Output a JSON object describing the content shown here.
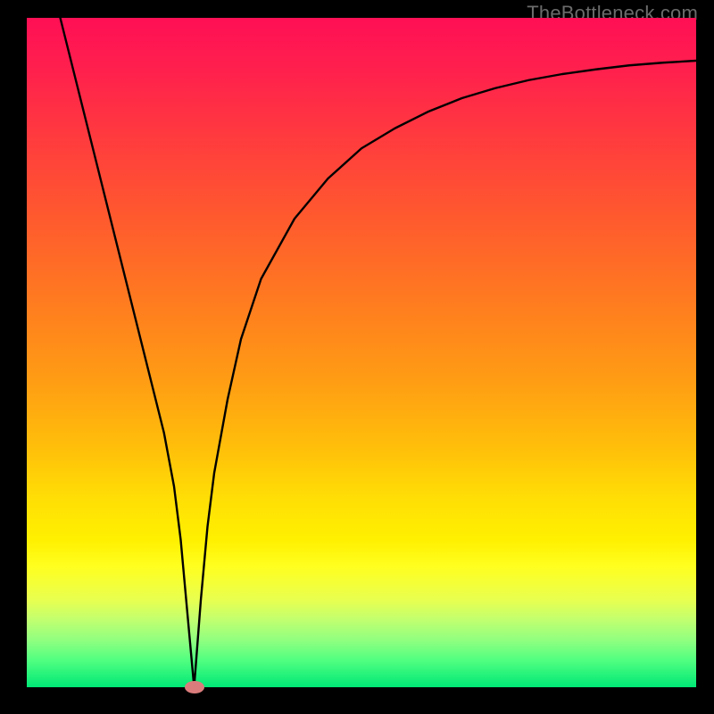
{
  "watermark": "TheBottleneck.com",
  "chart_data": {
    "type": "line",
    "title": "",
    "xlabel": "",
    "ylabel": "",
    "xlim": [
      0,
      100
    ],
    "ylim": [
      0,
      100
    ],
    "series": [
      {
        "name": "curve",
        "x": [
          5,
          7,
          9,
          11,
          13,
          15,
          17,
          19,
          20.5,
          22,
          23,
          24,
          25,
          26,
          27,
          28,
          30,
          32,
          35,
          40,
          45,
          50,
          55,
          60,
          65,
          70,
          75,
          80,
          85,
          90,
          95,
          100
        ],
        "values": [
          100,
          92,
          84,
          76,
          68,
          60,
          52,
          44,
          38,
          30,
          22,
          11,
          0,
          13,
          24,
          32,
          43,
          52,
          61,
          70,
          76,
          80.5,
          83.5,
          86,
          88,
          89.5,
          90.7,
          91.6,
          92.3,
          92.9,
          93.3,
          93.6
        ]
      }
    ],
    "marker": {
      "x": 25,
      "y": 0,
      "color": "#db7c7c"
    },
    "background_gradient": {
      "top": "#ff0f55",
      "mid_upper": "#ff7a20",
      "mid": "#ffdf05",
      "mid_lower": "#c0ff70",
      "bottom": "#00e876"
    }
  }
}
